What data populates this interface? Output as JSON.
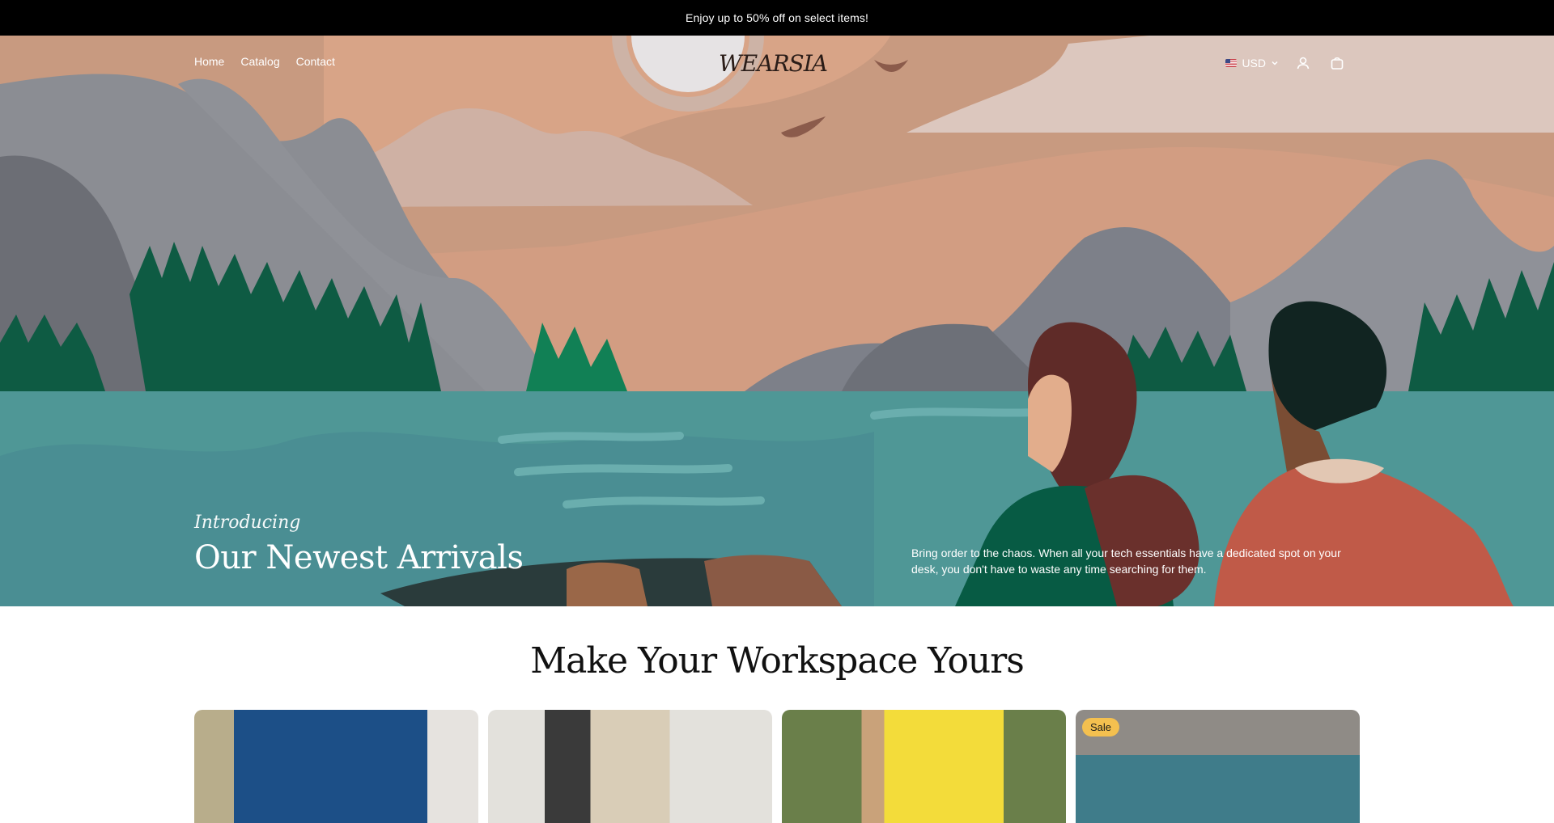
{
  "announcement": {
    "text": "Enjoy up to 50% off on select items!"
  },
  "nav": {
    "links": [
      "Home",
      "Catalog",
      "Contact"
    ],
    "logo_text": "WEARSIA",
    "currency": "USD"
  },
  "hero": {
    "kicker": "Introducing",
    "title": "Our Newest Arrivals",
    "description": "Bring order to the chaos. When all your tech essentials have a dedicated spot on your desk, you don't have to waste any time searching for them."
  },
  "section": {
    "title": "Make Your Workspace Yours"
  },
  "products": [
    {
      "badge": "",
      "colors": [
        "#b8ad8b",
        "#1c4f87",
        "#e6e3df"
      ]
    },
    {
      "badge": "",
      "colors": [
        "#e3e1dc",
        "#3a3a3a",
        "#d9cdb7"
      ]
    },
    {
      "badge": "",
      "colors": [
        "#6a7f4a",
        "#f3dc3a",
        "#c9a27a"
      ]
    },
    {
      "badge": "Sale",
      "colors": [
        "#8f8b86",
        "#e9e6e1",
        "#3f7c8a"
      ]
    }
  ],
  "colors": {
    "accent_badge": "#f4c04f",
    "lake": "#4f9796",
    "sky": "#d49a7a"
  }
}
